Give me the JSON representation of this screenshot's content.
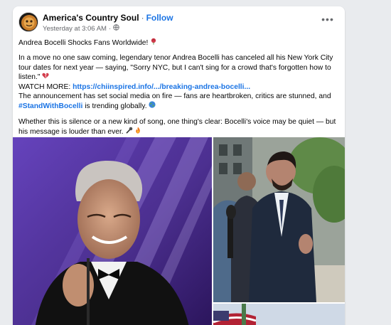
{
  "post": {
    "page_name": "America's Country Soul",
    "separator": "·",
    "follow_label": "Follow",
    "timestamp": "Yesterday at 3:06 AM",
    "meta_separator": "·",
    "more_label": "•••",
    "headline": "Andrea Bocelli Shocks Fans Worldwide!",
    "para1": "In a move no one saw coming, legendary tenor Andrea Bocelli has canceled all his New York City tour dates for next year — saying, \"Sorry NYC, but I can't sing for a crowd that's forgotten how to listen.\"",
    "watch_more_label": "WATCH MORE:",
    "watch_more_link": "https://chiinspired.info/.../breaking-andrea-bocelli...",
    "para2a": "The announcement has set social media on fire — fans are heartbroken, critics are stunned, and",
    "hashtag": "#StandWithBocelli",
    "para2b": "is trending globally.",
    "para3": "Whether this is silence or a new kind of song, one thing's clear: Bocelli's voice may be quiet — but his message is louder than ever."
  },
  "icons": {
    "audience": "globe-icon",
    "headline": "rose-icon",
    "para1": "broken-heart-icon",
    "trending": "globe-emoji-icon",
    "para3": [
      "microphone-icon",
      "fire-icon"
    ]
  },
  "colors": {
    "link": "#1b74e4",
    "text": "#050505",
    "meta": "#65676b",
    "background": "#e9ebee"
  }
}
